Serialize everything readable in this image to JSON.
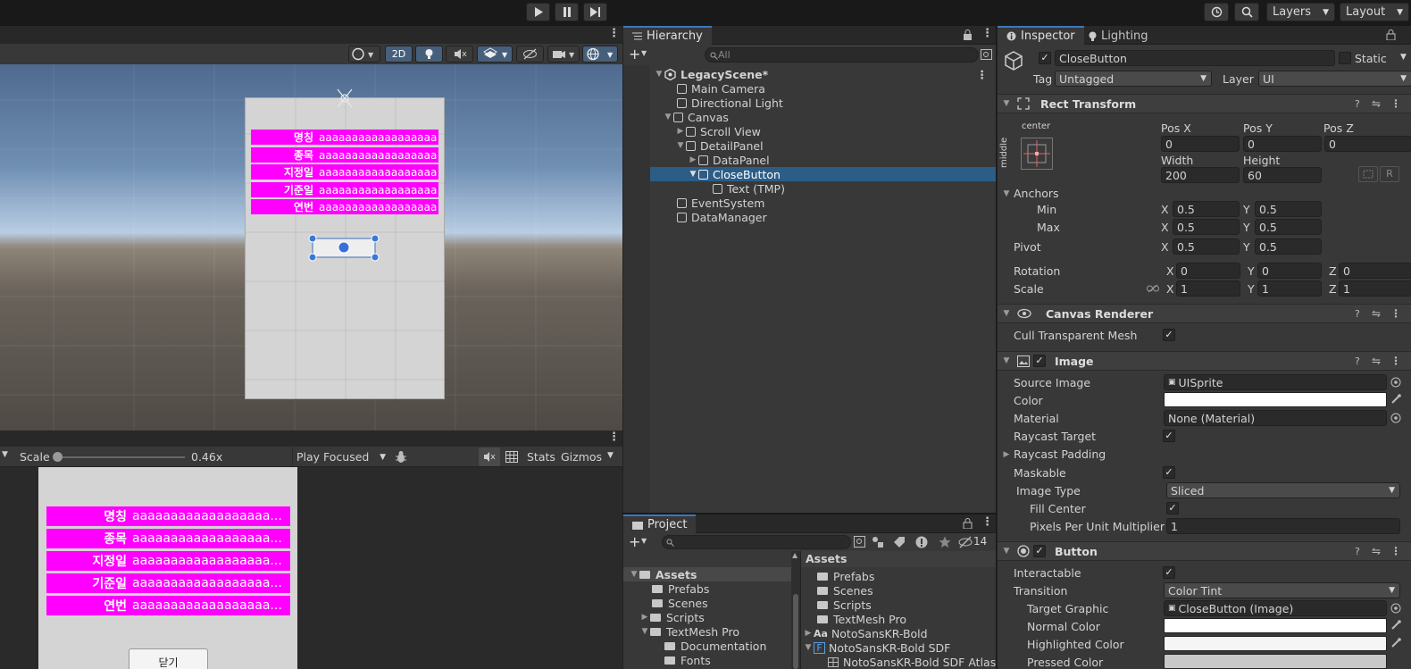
{
  "toolbar": {
    "play_icon": "play-icon",
    "pause_icon": "pause-icon",
    "step_icon": "step-icon",
    "layers_label": "Layers",
    "layout_label": "Layout"
  },
  "scene": {
    "mode_2d": "2D",
    "rows": [
      {
        "key": "명칭",
        "value": "aaaaaaaaaaaaaaaaaa"
      },
      {
        "key": "종목",
        "value": "aaaaaaaaaaaaaaaaaa"
      },
      {
        "key": "지정일",
        "value": "aaaaaaaaaaaaaaaaaa"
      },
      {
        "key": "기준일",
        "value": "aaaaaaaaaaaaaaaaaa"
      },
      {
        "key": "연번",
        "value": "aaaaaaaaaaaaaaaaaa"
      }
    ]
  },
  "game": {
    "scale_label": "Scale",
    "scale_value": "0.46x",
    "play_mode": "Play Focused",
    "stats": "Stats",
    "gizmos": "Gizmos",
    "rows": [
      {
        "key": "명칭",
        "value": "aaaaaaaaaaaaaaaaaa..."
      },
      {
        "key": "종목",
        "value": "aaaaaaaaaaaaaaaaaa..."
      },
      {
        "key": "지정일",
        "value": "aaaaaaaaaaaaaaaaaa..."
      },
      {
        "key": "기준일",
        "value": "aaaaaaaaaaaaaaaaaa..."
      },
      {
        "key": "연번",
        "value": "aaaaaaaaaaaaaaaaaa..."
      }
    ],
    "close_button": "닫기"
  },
  "hierarchy": {
    "tab": "Hierarchy",
    "search_placeholder": "All",
    "items": [
      {
        "label": "LegacyScene*"
      },
      {
        "label": "Main Camera"
      },
      {
        "label": "Directional Light"
      },
      {
        "label": "Canvas"
      },
      {
        "label": "Scroll View"
      },
      {
        "label": "DetailPanel"
      },
      {
        "label": "DataPanel"
      },
      {
        "label": "CloseButton"
      },
      {
        "label": "Text (TMP)"
      },
      {
        "label": "EventSystem"
      },
      {
        "label": "DataManager"
      }
    ]
  },
  "project": {
    "tab": "Project",
    "hidden_count": "14",
    "tree": [
      {
        "label": "Assets"
      },
      {
        "label": "Prefabs"
      },
      {
        "label": "Scenes"
      },
      {
        "label": "Scripts"
      },
      {
        "label": "TextMesh Pro"
      },
      {
        "label": "Documentation"
      },
      {
        "label": "Fonts"
      }
    ],
    "breadcrumb": "Assets",
    "files": [
      {
        "label": "Prefabs"
      },
      {
        "label": "Scenes"
      },
      {
        "label": "Scripts"
      },
      {
        "label": "TextMesh Pro"
      },
      {
        "label": "NotoSansKR-Bold"
      },
      {
        "label": "NotoSansKR-Bold SDF"
      },
      {
        "label": "NotoSansKR-Bold SDF Atlas"
      }
    ]
  },
  "inspector": {
    "tab": "Inspector",
    "tab2": "Lighting",
    "object_name": "CloseButton",
    "static_label": "Static",
    "tag_label": "Tag",
    "tag_value": "Untagged",
    "layer_label": "Layer",
    "layer_value": "UI",
    "rect": {
      "title": "Rect Transform",
      "anchor_h": "center",
      "anchor_v": "middle",
      "pos_x_label": "Pos X",
      "pos_y_label": "Pos Y",
      "pos_z_label": "Pos Z",
      "pos_x": "0",
      "pos_y": "0",
      "pos_z": "0",
      "width_label": "Width",
      "height_label": "Height",
      "width": "200",
      "height": "60",
      "anchors_label": "Anchors",
      "min_label": "Min",
      "max_label": "Max",
      "min_x": "0.5",
      "min_y": "0.5",
      "max_x": "0.5",
      "max_y": "0.5",
      "pivot_label": "Pivot",
      "pivot_x": "0.5",
      "pivot_y": "0.5",
      "rotation_label": "Rotation",
      "rot_x": "0",
      "rot_y": "0",
      "rot_z": "0",
      "scale_label": "Scale",
      "scale_x": "1",
      "scale_y": "1",
      "scale_z": "1",
      "r_btn": "R",
      "x": "X",
      "y": "Y",
      "z": "Z"
    },
    "canvas_renderer": {
      "title": "Canvas Renderer",
      "cull_label": "Cull Transparent Mesh"
    },
    "image": {
      "title": "Image",
      "source_label": "Source Image",
      "source_value": "UISprite",
      "color_label": "Color",
      "material_label": "Material",
      "material_value": "None (Material)",
      "raycast_label": "Raycast Target",
      "raycast_padding_label": "Raycast Padding",
      "maskable_label": "Maskable",
      "image_type_label": "Image Type",
      "image_type_value": "Sliced",
      "fill_center_label": "Fill Center",
      "ppu_label": "Pixels Per Unit Multiplier",
      "ppu_value": "1"
    },
    "button": {
      "title": "Button",
      "interactable_label": "Interactable",
      "transition_label": "Transition",
      "transition_value": "Color Tint",
      "target_label": "Target Graphic",
      "target_value": "CloseButton (Image)",
      "normal_label": "Normal Color",
      "highlighted_label": "Highlighted Color",
      "pressed_label": "Pressed Color"
    }
  },
  "colors": {
    "accent": "#3a79bb",
    "magenta": "#ff00ff",
    "selection": "#2c5d87"
  }
}
